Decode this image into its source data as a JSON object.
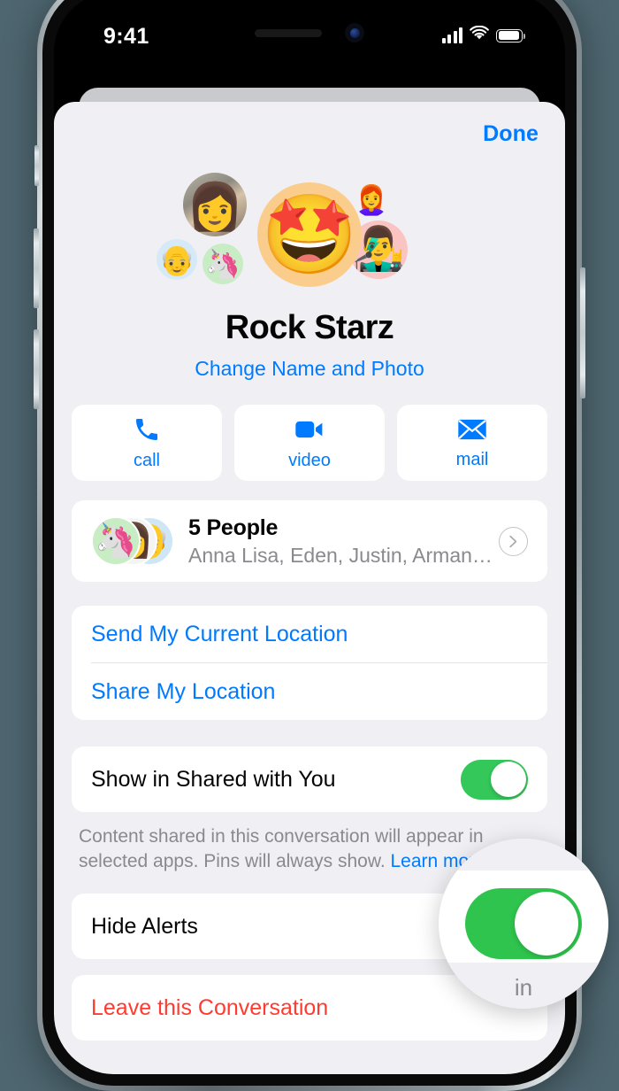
{
  "theme": {
    "accent_blue": "#007AFF",
    "toggle_green": "#34C759",
    "destructive_red": "#FF3B30",
    "sheet_bg": "#F0F0F4",
    "page_bg": "#4E6670"
  },
  "status_bar": {
    "time": "9:41",
    "signal_icon": "cellular-bars-icon",
    "wifi_icon": "wifi-icon",
    "battery_icon": "battery-icon"
  },
  "sheet": {
    "done_label": "Done",
    "group_name": "Rock Starz",
    "change_name_photo_label": "Change Name and Photo",
    "avatars": {
      "main_emoji": "🤩",
      "photo_emoji": "👩",
      "grandpa_emoji": "👴",
      "unicorn_emoji": "🦄",
      "pinkhair_emoji": "👩‍🦰",
      "shades_emoji": "👨‍🎤"
    },
    "actions": [
      {
        "label": "call",
        "icon": "phone-icon"
      },
      {
        "label": "video",
        "icon": "video-camera-icon"
      },
      {
        "label": "mail",
        "icon": "envelope-icon"
      }
    ],
    "people": {
      "title": "5 People",
      "subtitle": "Anna Lisa, Eden, Justin, Arman…",
      "chevron_icon": "chevron-right-icon",
      "avatars": {
        "front_emoji": "🦄",
        "middle_emoji": "👩",
        "back_emoji": "👴"
      }
    },
    "location": {
      "send_current_label": "Send My Current Location",
      "share_label": "Share My Location"
    },
    "shared_with_you": {
      "label": "Show in Shared with You",
      "toggle_state": "on",
      "footnote_text": "Content shared in this conversation will appear in selected apps. Pins will always show. ",
      "footnote_link": "Learn more"
    },
    "hide_alerts": {
      "label": "Hide Alerts",
      "toggle_state": "on"
    },
    "leave_conversation_label": "Leave this Conversation"
  },
  "magnifier": {
    "toggle_state": "on",
    "partial_text": "in"
  }
}
